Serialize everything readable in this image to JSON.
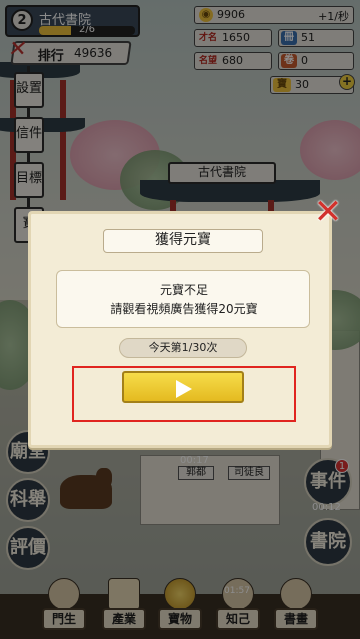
{
  "player": {
    "level": "2",
    "school_name": "古代書院",
    "exp_text": "2/6",
    "exp_fill": 0.33
  },
  "ranking": {
    "label": "排行",
    "value": "49636"
  },
  "resources": [
    {
      "icon": "coin-icon",
      "icon_text": "◉",
      "value": "9906",
      "rate": "+1/秒"
    },
    {
      "icon": "talent-icon",
      "icon_text": "才名",
      "value": "1650"
    },
    {
      "icon": "book-icon",
      "icon_text": "冊",
      "value": "51"
    },
    {
      "icon": "fame-icon",
      "icon_text": "名望",
      "value": "680"
    },
    {
      "icon": "scroll-icon",
      "icon_text": "卷",
      "value": "0"
    },
    {
      "icon": "ingot-icon",
      "icon_text": "寶",
      "value": "30"
    }
  ],
  "side_menu": [
    "設置",
    "信件",
    "目標",
    "寶"
  ],
  "building_sign": "古代書院",
  "dialog": {
    "title": "獲得元寶",
    "message_line1": "元寶不足",
    "message_line2": "請觀看視頻廣告獲得20元寶",
    "count_text": "今天第1/30次"
  },
  "npcs": [
    {
      "name": "郭都",
      "timer": "00:17"
    },
    {
      "name": "司徒良",
      "timer": ""
    }
  ],
  "left_buttons": [
    "廟堂",
    "科舉",
    "評價"
  ],
  "right_buttons": [
    {
      "label": "事件",
      "badge": "1",
      "timer": "00:12"
    },
    {
      "label": "書院"
    }
  ],
  "bottom_tabs": [
    {
      "label": "門生",
      "timer": ""
    },
    {
      "label": "產業",
      "timer": ""
    },
    {
      "label": "寶物",
      "timer": ""
    },
    {
      "label": "知己",
      "timer": "01:57"
    },
    {
      "label": "書畫",
      "timer": ""
    }
  ],
  "colors": {
    "accent_gold": "#f0c33c",
    "close_red": "#d2322d",
    "highlight_red": "#e0251f"
  }
}
